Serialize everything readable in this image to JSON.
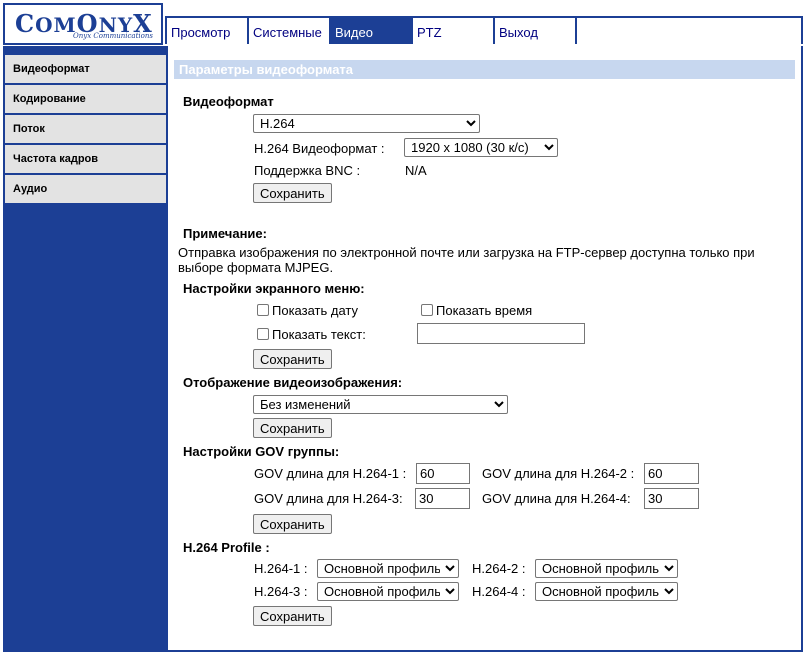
{
  "logo": {
    "part1_big": "C",
    "part1": "OM",
    "part2_big": "O",
    "part2": "NY",
    "part3_big": "X",
    "subtitle": "Onyx Communications"
  },
  "nav": {
    "tabs": [
      "Просмотр",
      "Системные",
      "Видео",
      "PTZ",
      "Выход"
    ],
    "active": "Видео"
  },
  "sidebar": {
    "items": [
      "Видеоформат",
      "Кодирование",
      "Поток",
      "Частота кадров",
      "Аудио"
    ]
  },
  "page_title": "Параметры видеоформата",
  "videoformat": {
    "title": "Видеоформат",
    "codec": "H.264",
    "h264_label": "H.264 Видеоформат :",
    "h264_value": "1920 x 1080 (30 к/с)",
    "bnc_label": "Поддержка BNC :",
    "bnc_value": "N/A",
    "save": "Сохранить"
  },
  "note": {
    "title": "Примечание:",
    "text": "Отправка изображения по электронной почте или загрузка на FTP-сервер доступна только при выборе формата MJPEG."
  },
  "osd": {
    "title": "Настройки экранного меню:",
    "show_date": "Показать дату",
    "show_time": "Показать время",
    "show_text": "Показать текст:",
    "text_value": "",
    "save": "Сохранить"
  },
  "display": {
    "title": "Отображение видеоизображения:",
    "value": "Без изменений",
    "save": "Сохранить"
  },
  "gov": {
    "title": "Настройки GOV группы:",
    "items": [
      {
        "label": "GOV длина для H.264-1 :",
        "value": "60"
      },
      {
        "label": "GOV длина для H.264-2 :",
        "value": "60"
      },
      {
        "label": "GOV длина для H.264-3:",
        "value": "30"
      },
      {
        "label": "GOV длина для H.264-4:",
        "value": "30"
      }
    ],
    "save": "Сохранить"
  },
  "profile": {
    "title": "H.264 Profile :",
    "items": [
      {
        "label": "H.264-1 :",
        "value": "Основной профиль"
      },
      {
        "label": "H.264-2 :",
        "value": "Основной профиль"
      },
      {
        "label": "H.264-3 :",
        "value": "Основной профиль"
      },
      {
        "label": "H.264-4 :",
        "value": "Основной профиль"
      }
    ],
    "save": "Сохранить"
  },
  "colors": {
    "brand": "#1c3f95",
    "title_bar": "#c7d7ef",
    "sidebar_item": "#e3e3e3"
  }
}
